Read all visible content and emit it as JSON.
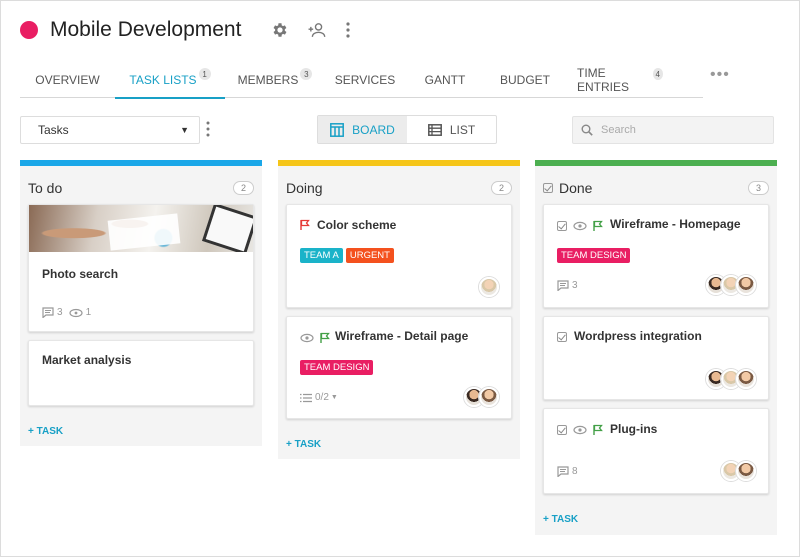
{
  "project": {
    "title": "Mobile Development",
    "color": "#e91e63"
  },
  "tabs": [
    {
      "label": "OVERVIEW",
      "badge": ""
    },
    {
      "label": "TASK LISTS",
      "badge": "1"
    },
    {
      "label": "MEMBERS",
      "badge": "3"
    },
    {
      "label": "SERVICES",
      "badge": ""
    },
    {
      "label": "GANTT",
      "badge": ""
    },
    {
      "label": "BUDGET",
      "badge": ""
    },
    {
      "label": "TIME ENTRIES",
      "badge": "4"
    }
  ],
  "toolbar": {
    "select_value": "Tasks",
    "board_label": "BOARD",
    "list_label": "LIST",
    "search_placeholder": "Search"
  },
  "colors": {
    "accent": "#18a0c6",
    "todo": "#1aa7e8",
    "doing": "#f5c518",
    "done": "#4caf50",
    "team_a": "#1ab3c9",
    "urgent": "#f4511e",
    "team_design": "#e91e63",
    "flag_red": "#e53935",
    "flag_green": "#43a047"
  },
  "columns": [
    {
      "name": "To do",
      "count": "2",
      "add_label": "+ TASK",
      "cards": [
        {
          "title": "Photo search",
          "comments": "3",
          "views": "1"
        },
        {
          "title": "Market analysis"
        }
      ]
    },
    {
      "name": "Doing",
      "count": "2",
      "add_label": "+ TASK",
      "cards": [
        {
          "title": "Color scheme",
          "tags": [
            "TEAM A",
            "URGENT"
          ]
        },
        {
          "title": "Wireframe - Detail page",
          "tags": [
            "TEAM DESIGN"
          ],
          "checklist": "0/2"
        }
      ]
    },
    {
      "name": "Done",
      "count": "3",
      "add_label": "+ TASK",
      "cards": [
        {
          "title": "Wireframe - Homepage",
          "tags": [
            "TEAM DESIGN"
          ],
          "comments": "3"
        },
        {
          "title": "Wordpress integration"
        },
        {
          "title": "Plug-ins",
          "comments": "8"
        }
      ]
    }
  ]
}
